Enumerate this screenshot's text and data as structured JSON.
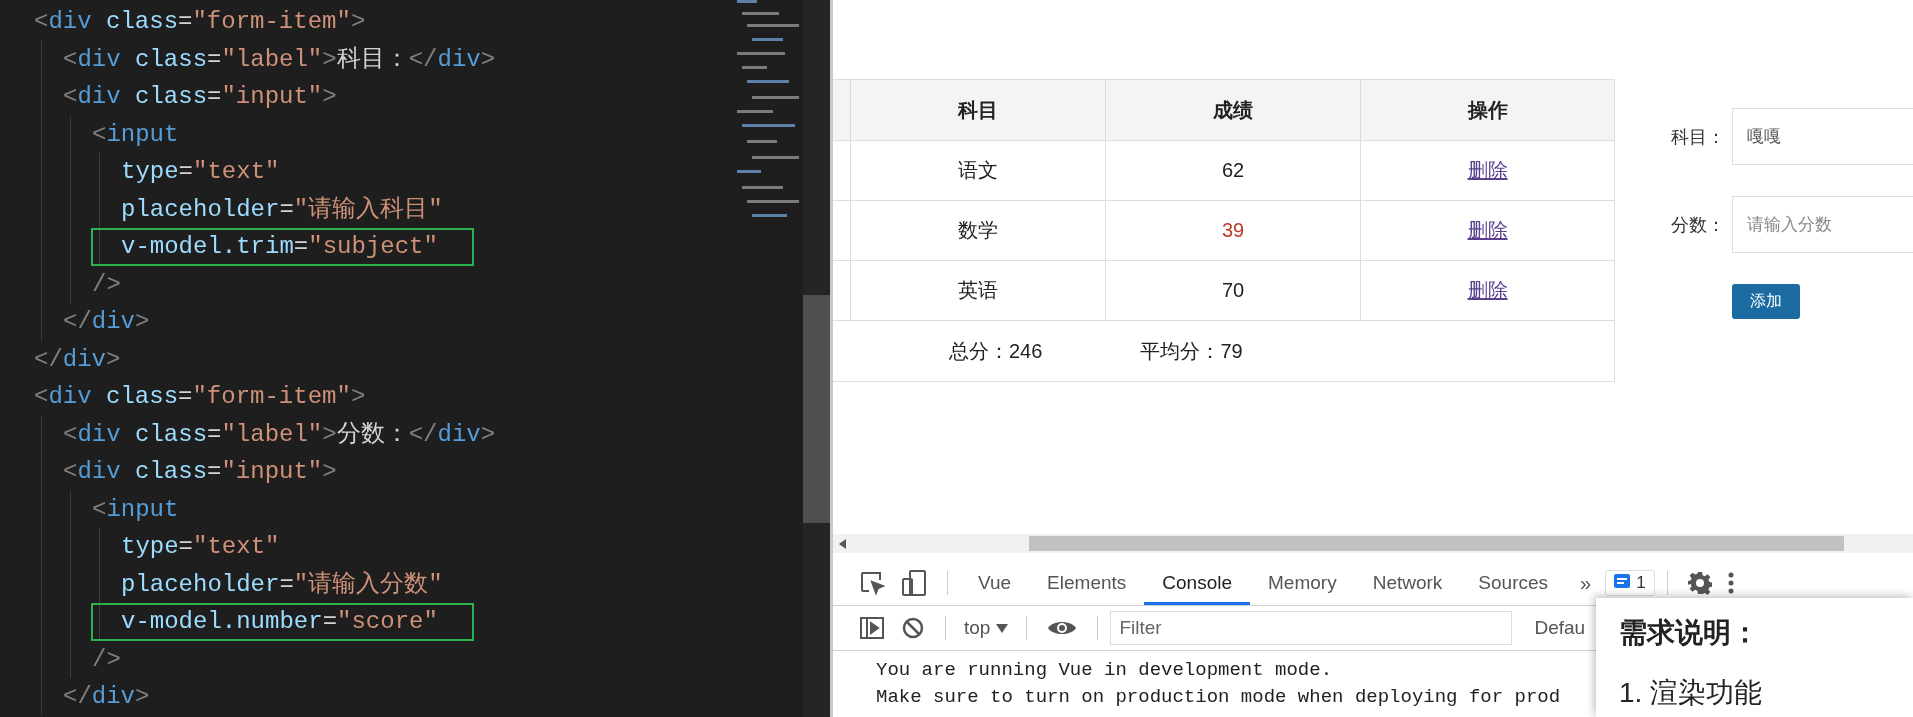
{
  "editor": {
    "lines": [
      {
        "highlighted": false,
        "tokens": [
          {
            "kind": "punct",
            "text": "<"
          },
          {
            "kind": "tag",
            "text": "div"
          },
          {
            "kind": "attr",
            "text": " class"
          },
          {
            "kind": "text",
            "text": "="
          },
          {
            "kind": "string",
            "text": "\"form-item\""
          },
          {
            "kind": "punct",
            "text": ">"
          }
        ],
        "children": [
          {
            "highlighted": false,
            "tokens": [
              {
                "kind": "punct",
                "text": "<"
              },
              {
                "kind": "tag",
                "text": "div"
              },
              {
                "kind": "attr",
                "text": " class"
              },
              {
                "kind": "text",
                "text": "="
              },
              {
                "kind": "string",
                "text": "\"label\""
              },
              {
                "kind": "punct",
                "text": ">"
              },
              {
                "kind": "text",
                "text": "科目："
              },
              {
                "kind": "punct",
                "text": "</"
              },
              {
                "kind": "tag",
                "text": "div"
              },
              {
                "kind": "punct",
                "text": ">"
              }
            ]
          },
          {
            "highlighted": false,
            "tokens": [
              {
                "kind": "punct",
                "text": "<"
              },
              {
                "kind": "tag",
                "text": "div"
              },
              {
                "kind": "attr",
                "text": " class"
              },
              {
                "kind": "text",
                "text": "="
              },
              {
                "kind": "string",
                "text": "\"input\""
              },
              {
                "kind": "punct",
                "text": ">"
              }
            ],
            "children": [
              {
                "highlighted": false,
                "tokens": [
                  {
                    "kind": "punct",
                    "text": "<"
                  },
                  {
                    "kind": "tag",
                    "text": "input"
                  }
                ],
                "children": [
                  {
                    "highlighted": false,
                    "tokens": [
                      {
                        "kind": "attr",
                        "text": "type"
                      },
                      {
                        "kind": "text",
                        "text": "="
                      },
                      {
                        "kind": "string",
                        "text": "\"text\""
                      }
                    ]
                  },
                  {
                    "highlighted": false,
                    "tokens": [
                      {
                        "kind": "attr",
                        "text": "placeholder"
                      },
                      {
                        "kind": "text",
                        "text": "="
                      },
                      {
                        "kind": "string",
                        "text": "\"请输入科目\""
                      }
                    ]
                  },
                  {
                    "highlighted": true,
                    "tokens": [
                      {
                        "kind": "attr",
                        "text": "v-model.trim"
                      },
                      {
                        "kind": "text",
                        "text": "="
                      },
                      {
                        "kind": "string",
                        "text": "\"subject\""
                      }
                    ]
                  }
                ]
              },
              {
                "highlighted": false,
                "tokens": [
                  {
                    "kind": "punct",
                    "text": "/>"
                  }
                ]
              }
            ]
          },
          {
            "highlighted": false,
            "tokens": [
              {
                "kind": "punct",
                "text": "</"
              },
              {
                "kind": "tag",
                "text": "div"
              },
              {
                "kind": "punct",
                "text": ">"
              }
            ]
          }
        ]
      },
      {
        "highlighted": false,
        "tokens": [
          {
            "kind": "punct",
            "text": "</"
          },
          {
            "kind": "tag",
            "text": "div"
          },
          {
            "kind": "punct",
            "text": ">"
          }
        ]
      },
      {
        "highlighted": false,
        "tokens": [
          {
            "kind": "punct",
            "text": "<"
          },
          {
            "kind": "tag",
            "text": "div"
          },
          {
            "kind": "attr",
            "text": " class"
          },
          {
            "kind": "text",
            "text": "="
          },
          {
            "kind": "string",
            "text": "\"form-item\""
          },
          {
            "kind": "punct",
            "text": ">"
          }
        ],
        "children": [
          {
            "highlighted": false,
            "tokens": [
              {
                "kind": "punct",
                "text": "<"
              },
              {
                "kind": "tag",
                "text": "div"
              },
              {
                "kind": "attr",
                "text": " class"
              },
              {
                "kind": "text",
                "text": "="
              },
              {
                "kind": "string",
                "text": "\"label\""
              },
              {
                "kind": "punct",
                "text": ">"
              },
              {
                "kind": "text",
                "text": "分数："
              },
              {
                "kind": "punct",
                "text": "</"
              },
              {
                "kind": "tag",
                "text": "div"
              },
              {
                "kind": "punct",
                "text": ">"
              }
            ]
          },
          {
            "highlighted": false,
            "tokens": [
              {
                "kind": "punct",
                "text": "<"
              },
              {
                "kind": "tag",
                "text": "div"
              },
              {
                "kind": "attr",
                "text": " class"
              },
              {
                "kind": "text",
                "text": "="
              },
              {
                "kind": "string",
                "text": "\"input\""
              },
              {
                "kind": "punct",
                "text": ">"
              }
            ],
            "children": [
              {
                "highlighted": false,
                "tokens": [
                  {
                    "kind": "punct",
                    "text": "<"
                  },
                  {
                    "kind": "tag",
                    "text": "input"
                  }
                ],
                "children": [
                  {
                    "highlighted": false,
                    "tokens": [
                      {
                        "kind": "attr",
                        "text": "type"
                      },
                      {
                        "kind": "text",
                        "text": "="
                      },
                      {
                        "kind": "string",
                        "text": "\"text\""
                      }
                    ]
                  },
                  {
                    "highlighted": false,
                    "tokens": [
                      {
                        "kind": "attr",
                        "text": "placeholder"
                      },
                      {
                        "kind": "text",
                        "text": "="
                      },
                      {
                        "kind": "string",
                        "text": "\"请输入分数\""
                      }
                    ]
                  },
                  {
                    "highlighted": true,
                    "tokens": [
                      {
                        "kind": "attr",
                        "text": "v-model.number"
                      },
                      {
                        "kind": "text",
                        "text": "="
                      },
                      {
                        "kind": "string",
                        "text": "\"score\""
                      }
                    ]
                  }
                ]
              },
              {
                "highlighted": false,
                "tokens": [
                  {
                    "kind": "punct",
                    "text": "/>"
                  }
                ]
              }
            ]
          },
          {
            "highlighted": false,
            "tokens": [
              {
                "kind": "punct",
                "text": "</"
              },
              {
                "kind": "tag",
                "text": "div"
              },
              {
                "kind": "punct",
                "text": ">"
              }
            ]
          }
        ]
      }
    ]
  },
  "browser": {
    "table": {
      "columns": [
        "科目",
        "成绩",
        "操作"
      ],
      "rows": [
        {
          "subject": "语文",
          "score": "62",
          "failing": false,
          "action": "删除"
        },
        {
          "subject": "数学",
          "score": "39",
          "failing": true,
          "action": "删除"
        },
        {
          "subject": "英语",
          "score": "70",
          "failing": false,
          "action": "删除"
        }
      ],
      "footer": {
        "total": "总分：246",
        "average": "平均分：79"
      }
    },
    "form": {
      "fields": [
        {
          "label": "科目：",
          "value": "嘎嘎"
        },
        {
          "label": "分数：",
          "placeholder": "请输入分数"
        }
      ],
      "submit": "添加"
    }
  },
  "devtools": {
    "tabs": [
      {
        "label": "Vue",
        "selected": false
      },
      {
        "label": "Elements",
        "selected": false
      },
      {
        "label": "Console",
        "selected": true
      },
      {
        "label": "Memory",
        "selected": false
      },
      {
        "label": "Network",
        "selected": false
      },
      {
        "label": "Sources",
        "selected": false
      }
    ],
    "more": "»",
    "issues_count": "1",
    "context": "top",
    "filter": {
      "placeholder": "Filter"
    },
    "levels": "Defau",
    "messages": [
      "You are running Vue in development mode.",
      "Make sure to turn on production mode when deploying for prod"
    ]
  },
  "note": {
    "title": "需求说明：",
    "items": [
      "1. 渲染功能"
    ]
  }
}
